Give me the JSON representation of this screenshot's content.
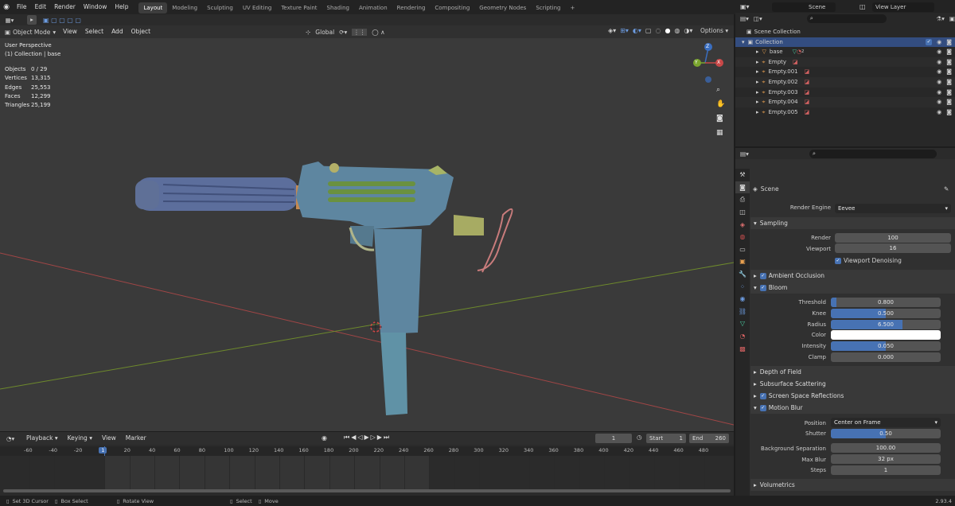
{
  "topbar": {
    "menus": [
      "File",
      "Edit",
      "Render",
      "Window",
      "Help"
    ],
    "workspaces": [
      "Layout",
      "Modeling",
      "Sculpting",
      "UV Editing",
      "Texture Paint",
      "Shading",
      "Animation",
      "Rendering",
      "Compositing",
      "Geometry Nodes",
      "Scripting"
    ],
    "active_workspace": "Layout",
    "add_tab": "+",
    "scene": "Scene",
    "view_layer": "View Layer"
  },
  "viewport": {
    "mode": "Object Mode",
    "menus": [
      "View",
      "Select",
      "Add",
      "Object"
    ],
    "transform": "Global",
    "options": "Options",
    "view_name": "User Perspective",
    "collection_path": "(1) Collection | base",
    "stats": [
      {
        "k": "Objects",
        "v": "0 / 29"
      },
      {
        "k": "Vertices",
        "v": "13,315"
      },
      {
        "k": "Edges",
        "v": "25,553"
      },
      {
        "k": "Faces",
        "v": "12,299"
      },
      {
        "k": "Triangles",
        "v": "25,199"
      }
    ],
    "gizmo": {
      "x": "X",
      "y": "Y",
      "z": "Z"
    }
  },
  "outliner": {
    "root": "Scene Collection",
    "collection": "Collection",
    "objects": [
      "base",
      "Empty",
      "Empty.001",
      "Empty.002",
      "Empty.003",
      "Empty.004",
      "Empty.005"
    ],
    "base_badge": "2"
  },
  "properties": {
    "context": "Scene",
    "render_engine_label": "Render Engine",
    "render_engine": "Eevee",
    "sampling": {
      "title": "Sampling",
      "render_label": "Render",
      "render": "100",
      "viewport_label": "Viewport",
      "viewport": "16",
      "denoise": "Viewport Denoising"
    },
    "ao": "Ambient Occlusion",
    "bloom": {
      "title": "Bloom",
      "fields": [
        {
          "label": "Threshold",
          "value": "0.800",
          "fill": 0.05
        },
        {
          "label": "Knee",
          "value": "0.500",
          "fill": 0.5
        },
        {
          "label": "Radius",
          "value": "6.500",
          "fill": 0.65
        },
        {
          "label": "Color",
          "value": "",
          "fill": 0
        },
        {
          "label": "Intensity",
          "value": "0.050",
          "fill": 0.5
        },
        {
          "label": "Clamp",
          "value": "0.000",
          "fill": 0
        }
      ]
    },
    "dof": "Depth of Field",
    "sss": "Subsurface Scattering",
    "ssr": "Screen Space Reflections",
    "mb": {
      "title": "Motion Blur",
      "position_label": "Position",
      "position": "Center on Frame",
      "shutter_label": "Shutter",
      "shutter": "0.50",
      "shutter_fill": 0.5,
      "bg_label": "Background Separation",
      "bg": "100.00",
      "maxblur_label": "Max Blur",
      "maxblur": "32 px",
      "steps_label": "Steps",
      "steps": "1"
    },
    "volumetrics": "Volumetrics"
  },
  "timeline": {
    "menus": [
      "Playback",
      "Keying",
      "View",
      "Marker"
    ],
    "current_frame": "1",
    "start_label": "Start",
    "start": "1",
    "end_label": "End",
    "end": "260",
    "ticks": [
      "-60",
      "-40",
      "-20",
      "1",
      "20",
      "40",
      "60",
      "80",
      "100",
      "120",
      "140",
      "160",
      "180",
      "200",
      "220",
      "240",
      "260",
      "280",
      "300",
      "320",
      "340",
      "360",
      "380",
      "400",
      "420",
      "440",
      "460",
      "480"
    ]
  },
  "status": {
    "items": [
      "Set 3D Cursor",
      "Box Select",
      "Rotate View",
      "Select",
      "Move"
    ],
    "version": "2.93.4"
  },
  "colors": {
    "accent": "#4772b3",
    "viewport_bg": "#3a3a3a",
    "x_axis": "#b04a4a",
    "y_axis": "#6e8a2c"
  }
}
